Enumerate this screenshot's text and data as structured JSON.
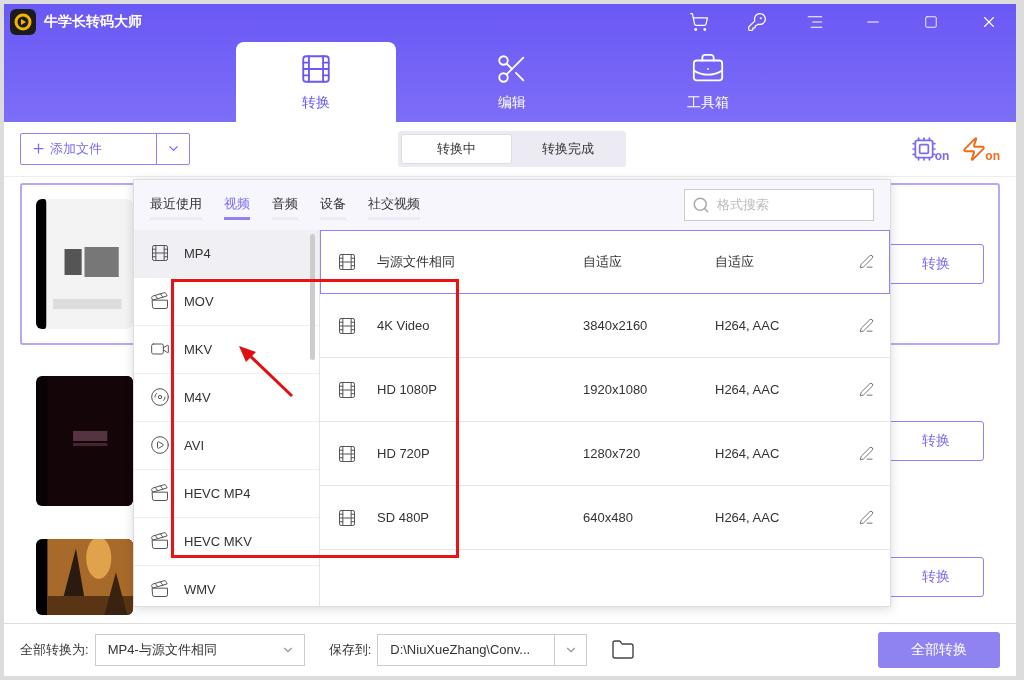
{
  "window": {
    "title": "牛学长转码大师"
  },
  "main_tabs": [
    {
      "label": "转换",
      "selected": true
    },
    {
      "label": "编辑",
      "selected": false
    },
    {
      "label": "工具箱",
      "selected": false
    }
  ],
  "toolbar": {
    "add_button": "添加文件",
    "status_tabs": [
      {
        "label": "转换中",
        "selected": true
      },
      {
        "label": "转换完成",
        "selected": false
      }
    ],
    "gpu_badge": "on",
    "speed_badge": "on"
  },
  "files": [
    {
      "selected": true,
      "button": "转换"
    },
    {
      "selected": false,
      "button": "转换"
    },
    {
      "selected": false,
      "button": "转换"
    }
  ],
  "format_panel": {
    "categories": [
      {
        "label": "最近使用",
        "selected": false
      },
      {
        "label": "视频",
        "selected": true
      },
      {
        "label": "音频",
        "selected": false
      },
      {
        "label": "设备",
        "selected": false
      },
      {
        "label": "社交视频",
        "selected": false
      }
    ],
    "search": {
      "placeholder": "格式搜索"
    },
    "formats": [
      {
        "label": "MP4",
        "selected": true
      },
      {
        "label": "MOV",
        "selected": false
      },
      {
        "label": "MKV",
        "selected": false
      },
      {
        "label": "M4V",
        "selected": false
      },
      {
        "label": "AVI",
        "selected": false
      },
      {
        "label": "HEVC MP4",
        "selected": false
      },
      {
        "label": "HEVC MKV",
        "selected": false
      },
      {
        "label": "WMV",
        "selected": false
      }
    ],
    "presets": [
      {
        "name": "与源文件相同",
        "resolution": "自适应",
        "codec": "自适应",
        "selected": true
      },
      {
        "name": "4K Video",
        "resolution": "3840x2160",
        "codec": "H264, AAC",
        "selected": false
      },
      {
        "name": "HD 1080P",
        "resolution": "1920x1080",
        "codec": "H264, AAC",
        "selected": false
      },
      {
        "name": "HD 720P",
        "resolution": "1280x720",
        "codec": "H264, AAC",
        "selected": false
      },
      {
        "name": "SD 480P",
        "resolution": "640x480",
        "codec": "H264, AAC",
        "selected": false
      }
    ]
  },
  "footer": {
    "convert_all_label": "全部转换为:",
    "convert_all_value": "MP4-与源文件相同",
    "save_label": "保存到:",
    "save_path": "D:\\NiuXueZhang\\Conv...",
    "convert_all_button": "全部转换"
  }
}
